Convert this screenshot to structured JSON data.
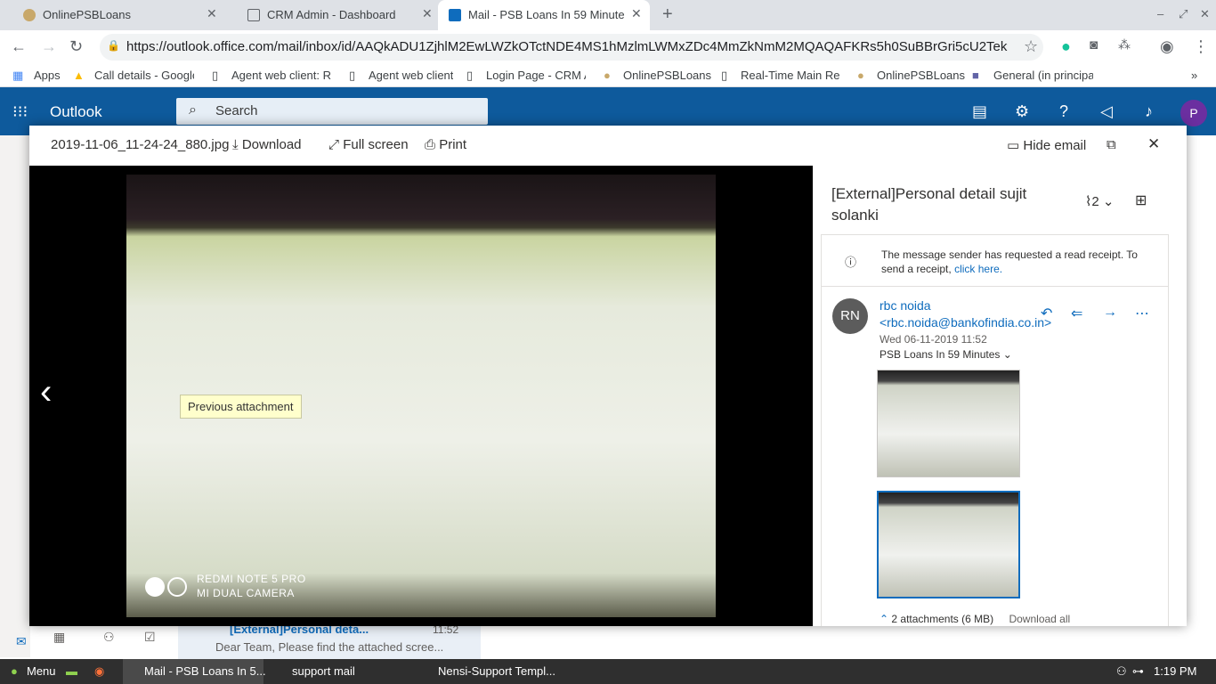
{
  "browser": {
    "tabs": [
      {
        "label": "OnlinePSBLoans"
      },
      {
        "label": "CRM Admin - Dashboard"
      },
      {
        "label": "Mail - PSB Loans In 59 Minutes"
      }
    ],
    "url": "https://outlook.office.com/mail/inbox/id/AAQkADU1ZjhlM2EwLWZkOTctNDE4MS1hMzlmLWMxZDc4MmZkNmM2MQAQAFKRs5h0SuBBrGri5cU2Tek%..."
  },
  "bookmarks": [
    {
      "label": "Apps"
    },
    {
      "label": "Call details - Google"
    },
    {
      "label": "Agent web client: Re"
    },
    {
      "label": "Agent web client"
    },
    {
      "label": "Login Page - CRM Ad"
    },
    {
      "label": "OnlinePSBLoans"
    },
    {
      "label": "Real-Time Main Rep"
    },
    {
      "label": "OnlinePSBLoans"
    },
    {
      "label": "General (in principal"
    }
  ],
  "outlook": {
    "app_name": "Outlook",
    "search_placeholder": "Search",
    "profile_initial": "P"
  },
  "viewer": {
    "filename": "2019-11-06_11-24-24_880.jpg",
    "download_label": "Download",
    "fullscreen_label": "Full screen",
    "print_label": "Print",
    "hide_email_label": "Hide email",
    "prev_tooltip": "Previous attachment",
    "camera_line1": "REDMI NOTE 5 PRO",
    "camera_line2": "MI DUAL CAMERA"
  },
  "email": {
    "subject": "[External]Personal detail sujit solanki",
    "attachment_count": "2",
    "receipt_text": "The message sender has requested a read receipt. To send a receipt,",
    "receipt_link": "click here.",
    "avatar_initials": "RN",
    "sender": "rbc noida <rbc.noida@bankofindia.co.in>",
    "date": "Wed 06-11-2019 11:52",
    "to": "PSB Loans In 59 Minutes",
    "attachments_summary": "2 attachments (6 MB)",
    "download_all": "Download all"
  },
  "background_list": {
    "subject": "[External]Personal deta...",
    "time": "11:52",
    "preview": "Dear Team, Please find the attached scree..."
  },
  "taskbar": {
    "menu": "Menu",
    "items": [
      {
        "label": "Mail - PSB Loans In 5..."
      },
      {
        "label": "support mail"
      },
      {
        "label": "Nensi-Support Templ..."
      }
    ],
    "clock": "1:19 PM"
  }
}
